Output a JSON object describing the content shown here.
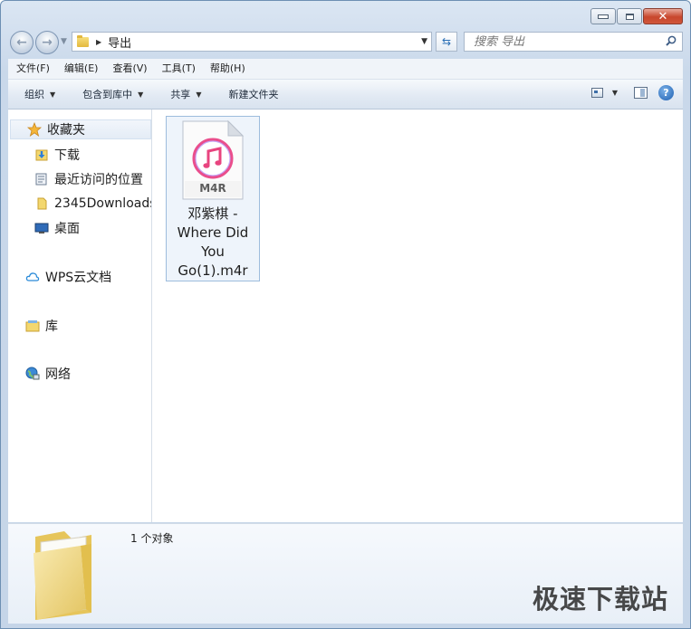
{
  "window": {
    "buttons": [
      "minimize",
      "maximize",
      "close"
    ]
  },
  "address": {
    "breadcrumb": "导出"
  },
  "search": {
    "placeholder": "搜索 导出"
  },
  "menu": {
    "items": [
      "文件(F)",
      "编辑(E)",
      "查看(V)",
      "工具(T)",
      "帮助(H)"
    ]
  },
  "toolbar": {
    "organize": "组织",
    "include_in_library": "包含到库中",
    "share": "共享",
    "new_folder": "新建文件夹"
  },
  "nav": {
    "favorites": "收藏夹",
    "downloads": "下载",
    "recent": "最近访问的位置",
    "downloads2345": "2345Downloads",
    "desktop": "桌面",
    "wps": "WPS云文档",
    "library": "库",
    "network": "网络"
  },
  "file": {
    "name_line1": "邓紫棋 -",
    "name_line2": "Where Did",
    "name_line3": "You",
    "name_line4": "Go(1).m4r",
    "badge": "M4R"
  },
  "details": {
    "count": "1 个对象"
  },
  "watermark": {
    "text": "极速下载站"
  },
  "colors": {
    "accent": "#2a6fb5",
    "selection": "#eef4fb",
    "folder": "#f3d76e"
  }
}
